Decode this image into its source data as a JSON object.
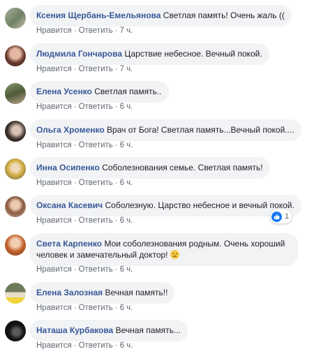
{
  "actions": {
    "like": "Нравится",
    "reply": "Ответить",
    "separator": "·"
  },
  "comments": [
    {
      "author": "Ксения Щербань-Емельянова",
      "text": "Светлая память! Очень жаль ((",
      "time": "7 ч."
    },
    {
      "author": "Людмила Гончарова",
      "text": "Царствие небесное. Вечный покой.",
      "time": "7 ч."
    },
    {
      "author": "Елена Усенко",
      "text": "Светлая память..",
      "time": "6 ч."
    },
    {
      "author": "Ольга Хроменко",
      "text": "Врач от Бога! Светлая память...Вечный покой....",
      "time": "6 ч."
    },
    {
      "author": "Инна Осипенко",
      "text": "Соболезнования семье. Светлая память!",
      "time": "6 ч."
    },
    {
      "author": "Оксана Касевич",
      "text": "Соболезную. Царство небесное и вечный покой.",
      "time": "6 ч.",
      "reactions": "1"
    },
    {
      "author": "Света Карпенко",
      "text": "Мои соболезнования родным. Очень хороший человек и замечательный доктор!",
      "time": "6 ч.",
      "emoji": "sad-face-emoji"
    },
    {
      "author": "Елена Залозная",
      "text": "Вечная память!!",
      "time": "6 ч."
    },
    {
      "author": "Наташа Курбакова",
      "text": "Вечная память...",
      "time": "6 ч."
    }
  ],
  "colors": {
    "author": "#385898",
    "bubble": "#f2f3f5",
    "meta": "#606770",
    "like": "#1877f2"
  }
}
